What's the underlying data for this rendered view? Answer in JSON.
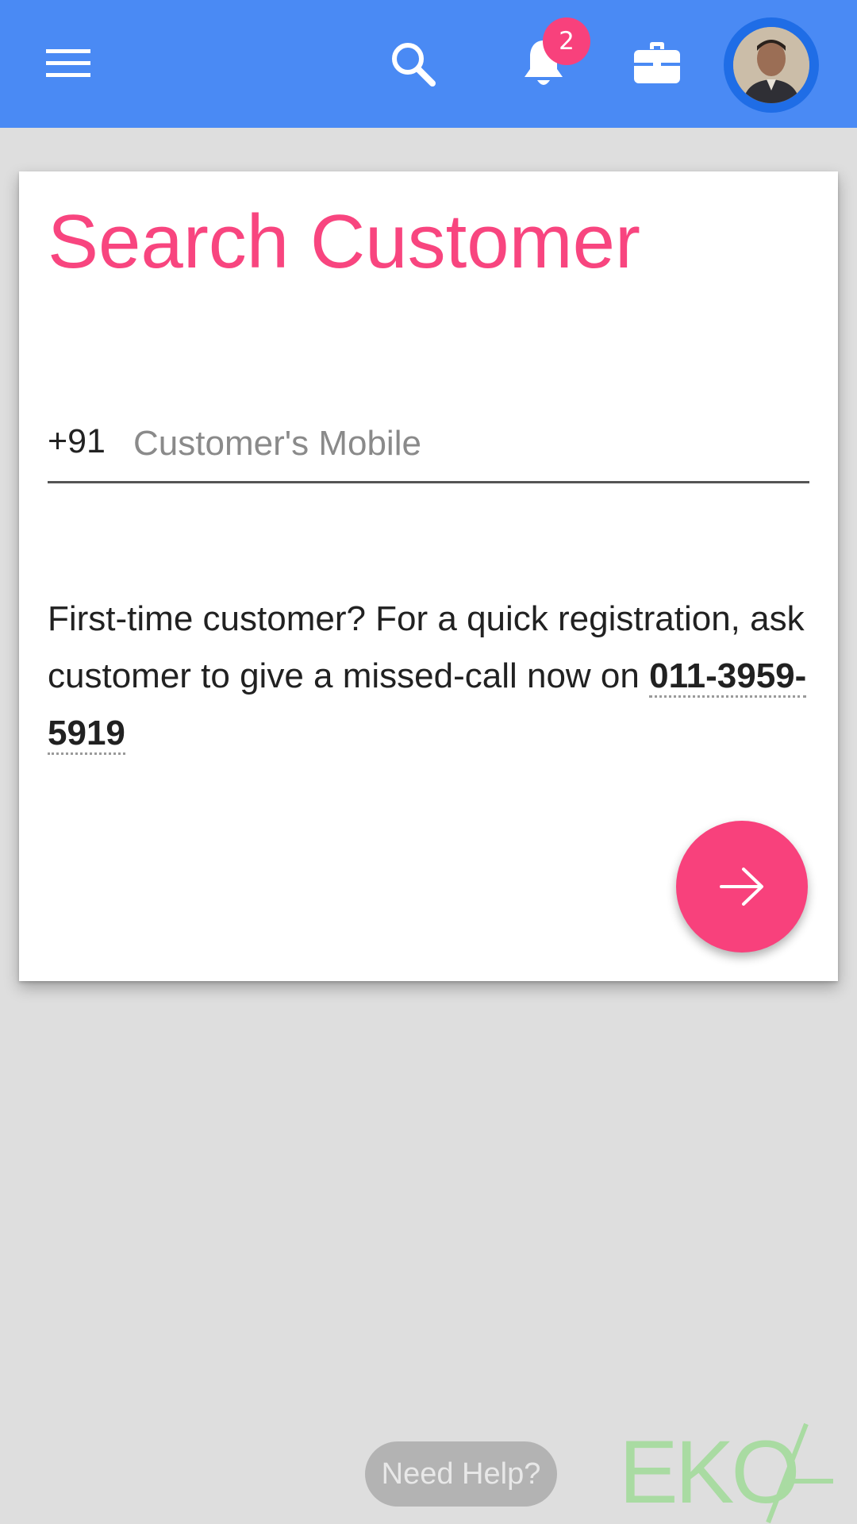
{
  "header": {
    "notification_count": "2",
    "icons": [
      "menu-icon",
      "search-icon",
      "bell-icon",
      "briefcase-icon",
      "avatar"
    ],
    "background_color": "#4a8af4"
  },
  "card": {
    "title": "Search Customer",
    "country_code": "+91",
    "mobile_placeholder": "Customer's Mobile",
    "mobile_value": "",
    "info_text_prefix": "First-time customer? For a quick registration, ask customer to give a missed-call now on ",
    "missed_call_number": "011-3959-5919"
  },
  "footer": {
    "help_label": "Need Help?",
    "logo_text": "EKO"
  },
  "colors": {
    "accent": "#f8417c",
    "title": "#f8457f",
    "page_background": "#dedede"
  }
}
